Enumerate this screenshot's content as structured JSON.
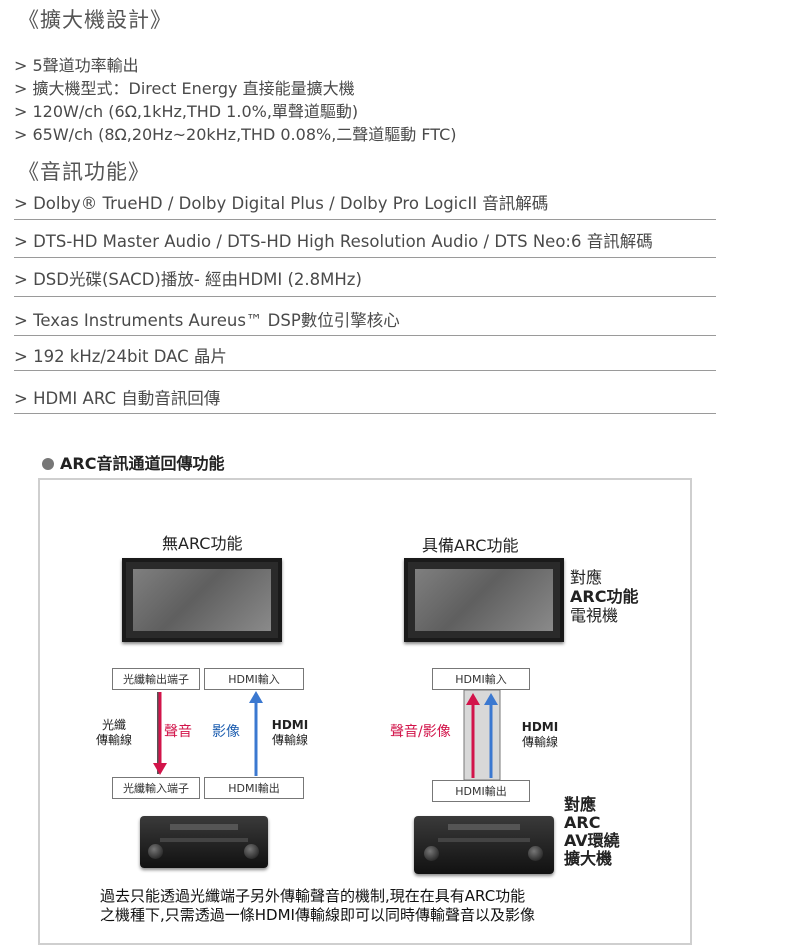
{
  "amp_section": {
    "heading": "《擴大機設計》",
    "items": [
      "> 5聲道功率輸出",
      "> 擴大機型式：Direct Energy 直接能量擴大機",
      "> 120W/ch (6Ω,1kHz,THD 1.0%,單聲道驅動)",
      "> 65W/ch (8Ω,20Hz~20kHz,THD 0.08%,二聲道驅動 FTC)"
    ]
  },
  "audio_section": {
    "heading": "《音訊功能》",
    "items": [
      "> Dolby® TrueHD / Dolby Digital Plus / Dolby Pro LogicII 音訊解碼",
      "> DTS-HD Master Audio / DTS-HD High Resolution Audio / DTS Neo:6 音訊解碼",
      "> DSD光碟(SACD)播放- 經由HDMI (2.8MHz)",
      "> Texas Instruments Aureus™ DSP數位引擎核心",
      "> 192 kHz/24bit DAC 晶片",
      "> HDMI ARC 自動音訊回傳"
    ]
  },
  "arc": {
    "title": "ARC音訊通道回傳功能",
    "left_title": "無ARC功能",
    "right_title": "具備ARC功能",
    "tv_label": [
      "對應",
      "ARC功能",
      "電視機"
    ],
    "amp_label": [
      "對應",
      "ARC",
      "AV環繞",
      "擴大機"
    ],
    "optical_out": "光纖輸出端子",
    "optical_in": "光纖輸入端子",
    "hdmi_in": "HDMI輸入",
    "hdmi_out": "HDMI輸出",
    "optical_cable": [
      "光纖",
      "傳輸線"
    ],
    "hdmi_cable": [
      "HDMI",
      "傳輸線"
    ],
    "sound": "聲音",
    "video": "影像",
    "sound_video": "聲音/影像",
    "caption": [
      "過去只能透過光纖端子另外傳輸聲音的機制,現在在具有ARC功能",
      "之機種下,只需透過一條HDMI傳輸線即可以同時傳輸聲音以及影像"
    ],
    "colors": {
      "audio_arrow": "#d2144a",
      "video_arrow": "#3b78d0"
    }
  }
}
